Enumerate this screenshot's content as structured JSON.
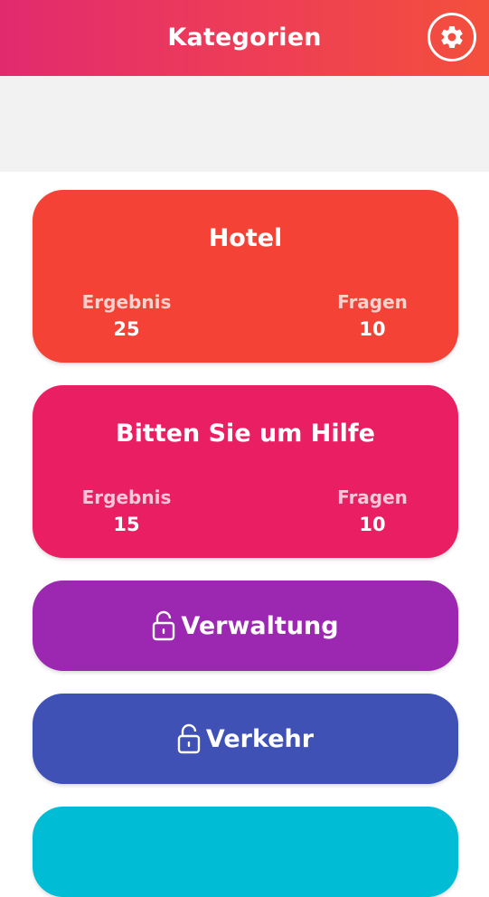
{
  "header": {
    "title": "Kategorien",
    "settings_icon": "gear-icon"
  },
  "categories": [
    {
      "title": "Hotel",
      "color": "#f44336",
      "score_label": "Ergebnis",
      "score": "25",
      "questions_label": "Fragen",
      "questions": "10",
      "locked": false
    },
    {
      "title": "Bitten Sie um Hilfe",
      "color": "#e91e63",
      "score_label": "Ergebnis",
      "score": "15",
      "questions_label": "Fragen",
      "questions": "10",
      "locked": false
    },
    {
      "title": "Verwaltung",
      "color": "#9c27b0",
      "locked": true,
      "icon": "lock-icon"
    },
    {
      "title": "Verkehr",
      "color": "#3f51b5",
      "locked": true,
      "icon": "lock-icon"
    },
    {
      "color": "#00bcd4",
      "locked": true
    }
  ]
}
